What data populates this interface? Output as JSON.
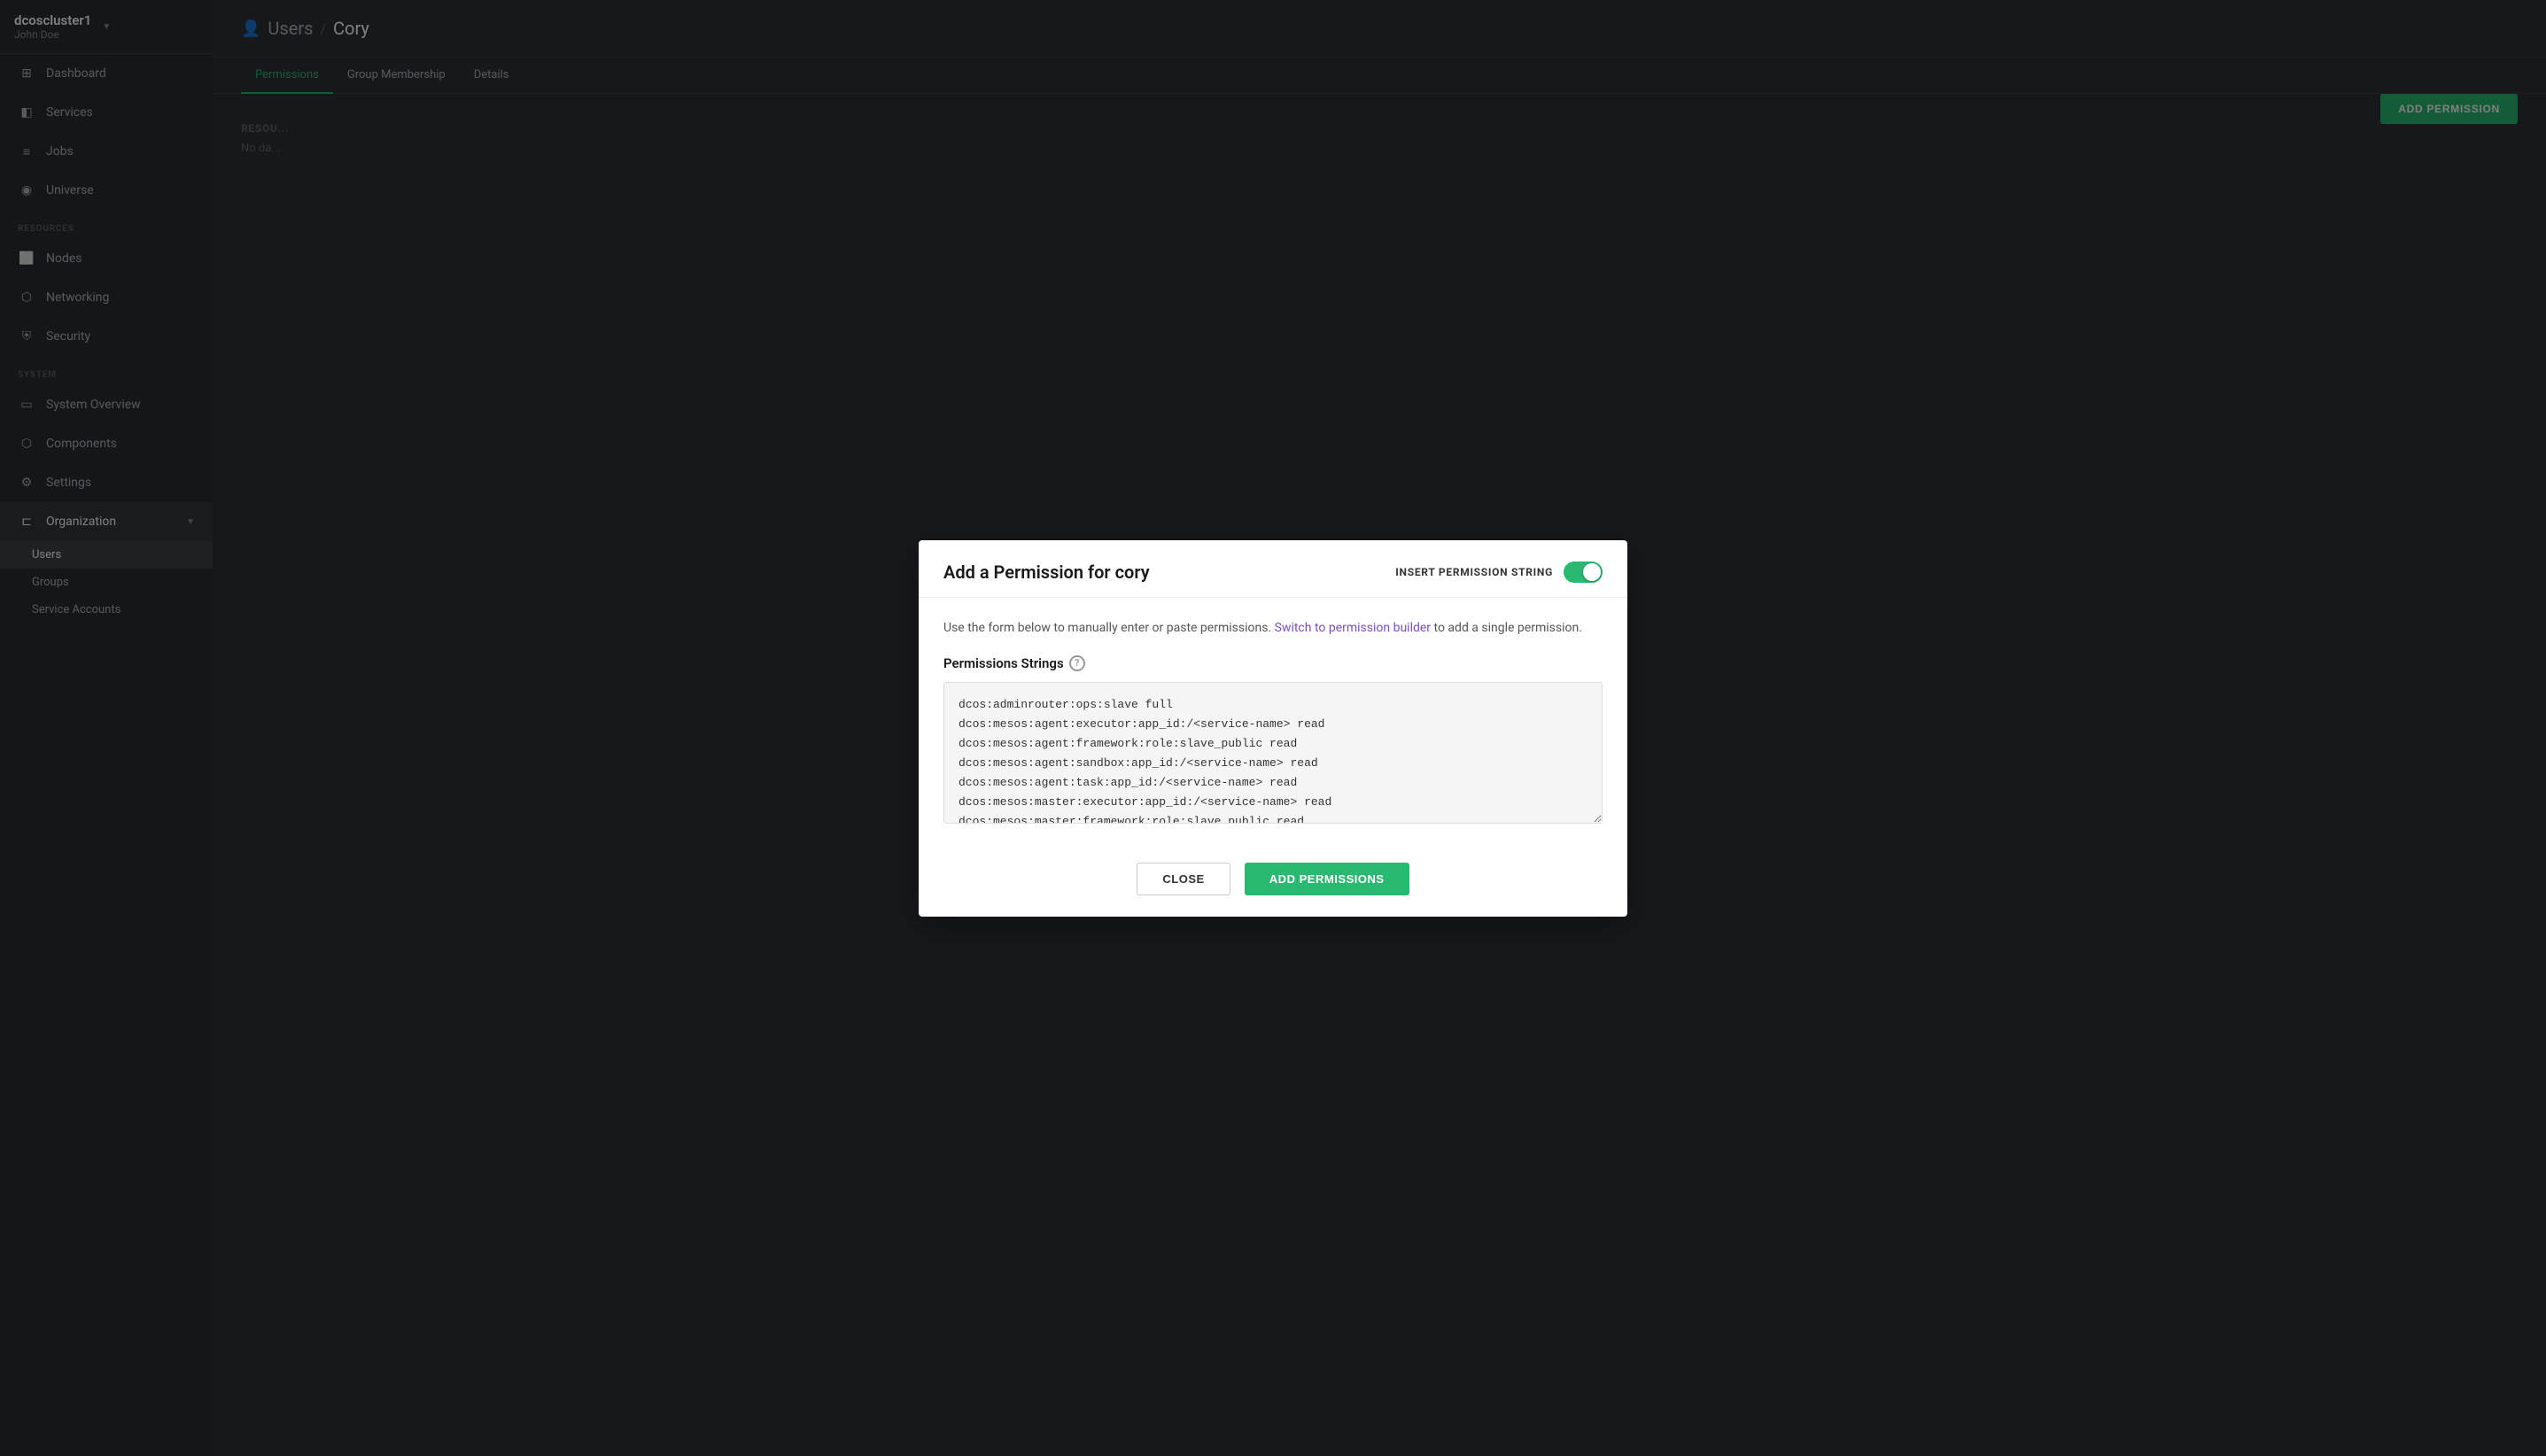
{
  "app": {
    "cluster_name": "dcoscluster1",
    "user_name": "John Doe"
  },
  "sidebar": {
    "nav_items": [
      {
        "id": "dashboard",
        "label": "Dashboard",
        "icon": "grid"
      },
      {
        "id": "services",
        "label": "Services",
        "icon": "layers"
      },
      {
        "id": "jobs",
        "label": "Jobs",
        "icon": "briefcase"
      },
      {
        "id": "universe",
        "label": "Universe",
        "icon": "globe"
      }
    ],
    "resources_section": "RESOURCES",
    "resources_items": [
      {
        "id": "nodes",
        "label": "Nodes",
        "icon": "server"
      },
      {
        "id": "networking",
        "label": "Networking",
        "icon": "network"
      },
      {
        "id": "security",
        "label": "Security",
        "icon": "shield"
      }
    ],
    "system_section": "SYSTEM",
    "system_items": [
      {
        "id": "system-overview",
        "label": "System Overview",
        "icon": "monitor"
      },
      {
        "id": "components",
        "label": "Components",
        "icon": "puzzle"
      },
      {
        "id": "settings",
        "label": "Settings",
        "icon": "gear"
      },
      {
        "id": "organization",
        "label": "Organization",
        "icon": "org",
        "has_chevron": true
      }
    ],
    "org_sub_items": [
      {
        "id": "users",
        "label": "Users",
        "active": true
      },
      {
        "id": "groups",
        "label": "Groups"
      },
      {
        "id": "service-accounts",
        "label": "Service Accounts"
      }
    ]
  },
  "header": {
    "breadcrumb_icon": "👤",
    "breadcrumb_parent": "Users",
    "breadcrumb_child": "Cory"
  },
  "tabs": [
    {
      "id": "permissions",
      "label": "Permissions",
      "active": true
    },
    {
      "id": "group-membership",
      "label": "Group Membership"
    },
    {
      "id": "details",
      "label": "Details"
    }
  ],
  "main": {
    "add_permission_btn": "ADD PERMISSION",
    "resource_section_label": "RESOUR..."
  },
  "modal": {
    "title": "Add a Permission for cory",
    "insert_permission_label": "INSERT PERMISSION STRING",
    "toggle_on": true,
    "description_text": "Use the form below to manually enter or paste permissions.",
    "description_link": "Switch to permission builder",
    "description_suffix": "to add a single permission.",
    "permissions_strings_label": "Permissions Strings",
    "permissions_content": "dcos:adminrouter:ops:slave full\ndcos:mesos:agent:executor:app_id:/<service-name> read\ndcos:mesos:agent:framework:role:slave_public read\ndcos:mesos:agent:sandbox:app_id:/<service-name> read\ndcos:mesos:agent:task:app_id:/<service-name> read\ndcos:mesos:master:executor:app_id:/<service-name> read\ndcos:mesos:master:framework:role:slave_public read\ndcos:mesos:master:task:app_id:/<service-name> read ",
    "close_btn": "CLOSE",
    "add_permissions_btn": "ADD  PERMISSIONS"
  }
}
